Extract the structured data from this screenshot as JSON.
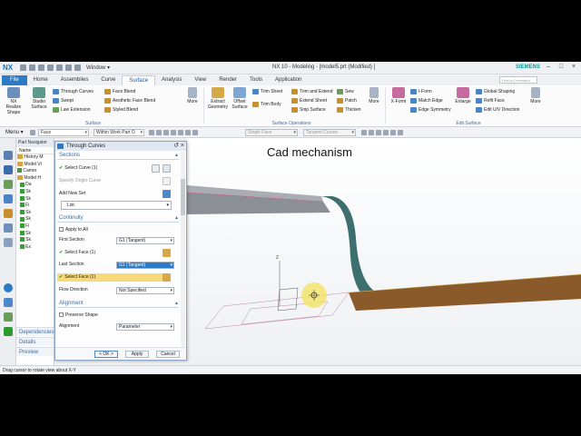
{
  "app": {
    "logo": "NX",
    "window_menu": "Window ▾",
    "title": "NX 10 - Modeling - [model5.prt (Modified) ]",
    "vendor": "SIEMENS"
  },
  "tabs": [
    "File",
    "Home",
    "Assemblies",
    "Curve",
    "Surface",
    "Analysis",
    "View",
    "Render",
    "Tools",
    "Application"
  ],
  "search_placeholder": "Find a Command",
  "ribbon": {
    "nx_realize": "NX Realize Shape",
    "studio_surface": "Studio Surface",
    "through_curves": "Through Curves",
    "swept": "Swept",
    "law_extension": "Law Extension",
    "face_blend": "Face Blend",
    "aesthetic_face_blend": "Aesthetic Face Blend",
    "styled_blend": "Styled Blend",
    "more1": "More",
    "extract_geometry": "Extract Geometry",
    "offset_surface": "Offset Surface",
    "trim_sheet": "Trim Sheet",
    "trim_body": "Trim Body",
    "trim_and_extend": "Trim and Extend",
    "extend_sheet": "Extend Sheet",
    "snip_surface": "Snip Surface",
    "sew": "Sew",
    "patch": "Patch",
    "thicken": "Thicken",
    "more2": "More",
    "x_form": "X-Form",
    "i_form": "I-Form",
    "match_edge": "Match Edge",
    "edge_symmetry": "Edge Symmetry",
    "enlarge": "Enlarge",
    "global_shaping": "Global Shaping",
    "refit_face": "Refit Face",
    "edit_uv_direction": "Edit U/V Direction",
    "more3": "More",
    "group_surface": "Surface",
    "group_surface_operations": "Surface Operations",
    "group_edit_surface": "Edit Surface"
  },
  "selbar": {
    "menu": "Menu ▾",
    "filter": "Face",
    "scope": "Within Work Part O",
    "edge_filter": "Single Face",
    "tangent_filter": "Tangent Curves"
  },
  "navigator": {
    "title": "Part Navigator",
    "name_col": "Name",
    "rows": [
      "History M",
      "Model Vi",
      "Camer",
      "Model H",
      "Da",
      "Sk",
      "Sk",
      "Fi",
      "Sk",
      "Sk",
      "Fi",
      "Sk",
      "Sk",
      "Ex"
    ],
    "dependencies": "Dependencies",
    "details": "Details",
    "preview": "Preview"
  },
  "dialog": {
    "title": "Through Curves",
    "sections": "Sections",
    "select_curve": "Select Curve (1)",
    "specify_origin_curve": "Specify Origin Curve",
    "add_new_set": "Add New Set",
    "list": "List",
    "continuity": "Continuity",
    "apply_to_all": "Apply to All",
    "first_section": "First Section",
    "first_section_value": "G1 (Tangent)",
    "select_face_1": "Select Face (1)",
    "last_section": "Last Section",
    "last_section_value": "G1 (Tangent)",
    "select_face_2": "Select Face (1)",
    "flow_direction": "Flow Direction",
    "flow_direction_value": "Not Specified",
    "alignment": "Alignment",
    "preserve_shape": "Preserve Shape",
    "alignment_label": "Alignment",
    "alignment_value": "Parameter",
    "ok": "< OK >",
    "apply": "Apply",
    "cancel": "Cancel"
  },
  "viewport": {
    "overlay_title": "Cad mechanism"
  },
  "status": "Drag cursor to rotate view about X-Y",
  "colors": {
    "accent": "#2d7bc7",
    "highlight": "#f7d87a",
    "surface_teal": "#3d6f6e",
    "face_brown": "#8a5a2b"
  }
}
